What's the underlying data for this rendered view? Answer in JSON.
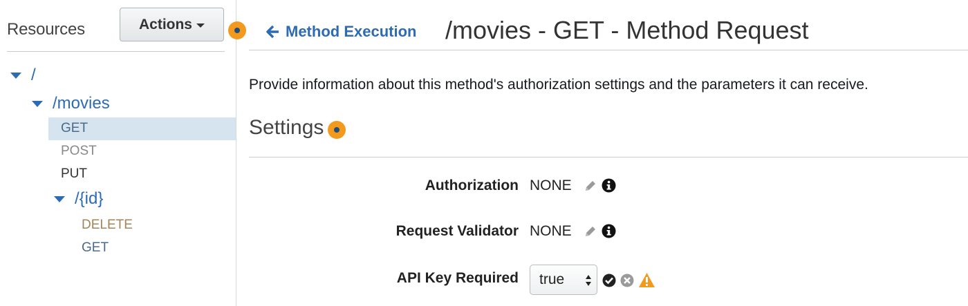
{
  "sidebar": {
    "title": "Resources",
    "actions_label": "Actions",
    "tree": {
      "root": "/",
      "movies": "/movies",
      "movies_methods": [
        "GET",
        "POST",
        "PUT"
      ],
      "id": "/{id}",
      "id_methods": [
        "DELETE",
        "GET"
      ]
    }
  },
  "header": {
    "back_label": "Method Execution",
    "title": "/movies - GET - Method Request"
  },
  "main": {
    "description": "Provide information about this method's authorization settings and the parameters it can receive.",
    "settings_heading": "Settings",
    "fields": [
      {
        "label": "Authorization",
        "value": "NONE"
      },
      {
        "label": "Request Validator",
        "value": "NONE"
      },
      {
        "label": "API Key Required",
        "value": "true"
      }
    ]
  },
  "colors": {
    "link": "#2d6bb3",
    "selected_row": "#d6e4f0",
    "callout_dot": "#f39a1e",
    "post": "#888888",
    "put": "#333333",
    "delete": "#a38457",
    "get": "#4a6a8a",
    "warning": "#f39a1e"
  },
  "icons": [
    "caret-down-icon",
    "arrow-left-icon",
    "pencil-icon",
    "info-icon",
    "check-circle-icon",
    "close-circle-icon",
    "warning-icon",
    "select-arrows-icon"
  ]
}
